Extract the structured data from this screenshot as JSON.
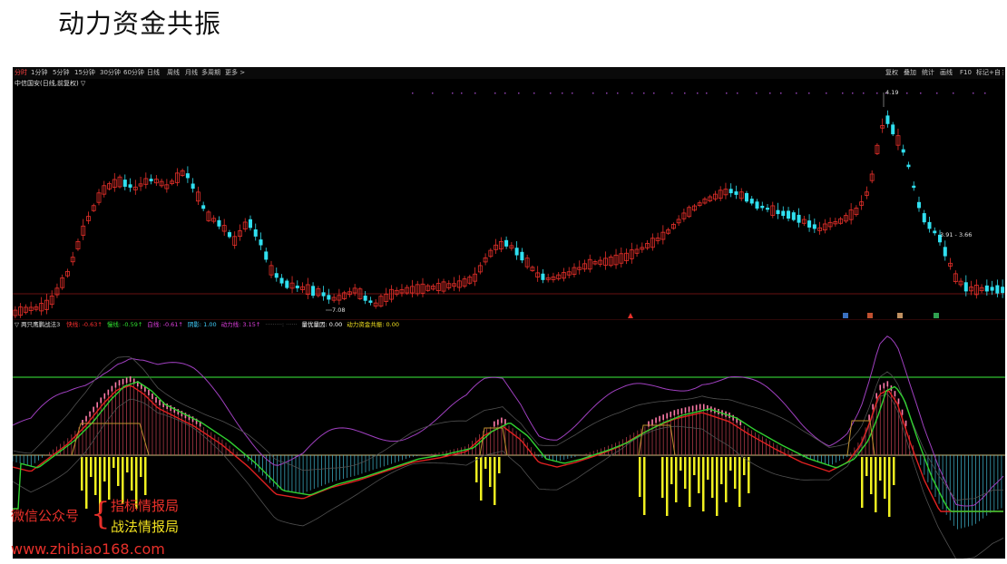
{
  "page": {
    "title": "动力资金共振"
  },
  "toolbar": {
    "tabs": [
      "分时",
      "1分钟",
      "5分钟",
      "15分钟",
      "30分钟",
      "60分钟",
      "日线",
      "周线",
      "月线",
      "多周期",
      "更多 >"
    ],
    "right_items": [
      "复权",
      "叠加",
      "统计",
      "画线",
      "F10",
      "标记",
      "+自",
      "⋮"
    ]
  },
  "stock": {
    "name": "中信国安(日线,前复权) ▽"
  },
  "price_chart": {
    "high_label": "4.19",
    "low_label": "7.08",
    "range_label": "3.91 - 3.66"
  },
  "indicator": {
    "name": "▽ 两只鹰鹏战法3",
    "items": [
      {
        "text": "快线: -0.63↑",
        "color": "#ff3030"
      },
      {
        "text": "慢线: -0.59↑",
        "color": "#30e030"
      },
      {
        "text": "白线: -0.61↑",
        "color": "#e040e0"
      },
      {
        "text": "阴影: 1.00",
        "color": "#40d0ff"
      },
      {
        "text": "动力线: 3.15↑",
        "color": "#e040e0"
      },
      {
        "text": "·········: ······",
        "color": "#606060"
      },
      {
        "text": "量优量因: 0.00",
        "color": "#ffffff"
      },
      {
        "text": "动力资金共振: 0.00",
        "color": "#f0e020"
      }
    ]
  },
  "watermark": {
    "label": "微信公众号",
    "line1": "指标情报局",
    "line2": "战法情报局",
    "url": "www.zhibiao168.com"
  },
  "colors": {
    "up": "#e8302a",
    "down": "#30e0f0",
    "background": "#000000",
    "threshold": "#30c030",
    "yellow_bar": "#f0f020"
  }
}
